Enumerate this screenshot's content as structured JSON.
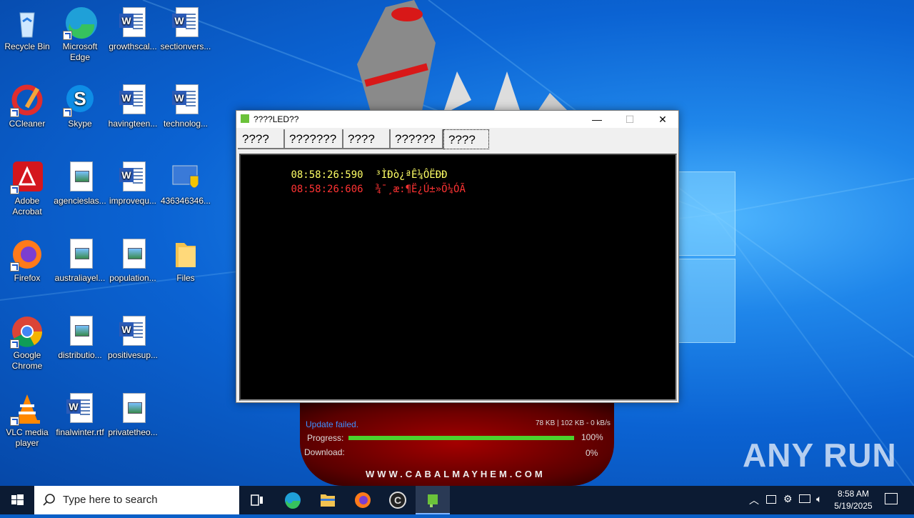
{
  "desktop": {
    "icons": [
      {
        "label": "Recycle Bin"
      },
      {
        "label": "Microsoft Edge"
      },
      {
        "label": "growthscal..."
      },
      {
        "label": "sectionvers..."
      },
      {
        "label": "CCleaner"
      },
      {
        "label": "Skype"
      },
      {
        "label": "havingteen..."
      },
      {
        "label": "technolog..."
      },
      {
        "label": "Adobe Acrobat"
      },
      {
        "label": "agencieslas..."
      },
      {
        "label": "improvequ..."
      },
      {
        "label": "436346346..."
      },
      {
        "label": "Firefox"
      },
      {
        "label": "australiayel..."
      },
      {
        "label": "population..."
      },
      {
        "label": "Files"
      },
      {
        "label": "Google Chrome"
      },
      {
        "label": "distributio..."
      },
      {
        "label": "positivesup..."
      },
      {
        "label": "VLC media player"
      },
      {
        "label": "finalwinter.rtf"
      },
      {
        "label": "privatetheo..."
      }
    ],
    "watermark": "ANY RUN"
  },
  "launcher": {
    "status": "Update failed.",
    "stats": "78 KB | 102 KB - 0 kB/s",
    "progress_label": "Progress:",
    "progress_pct": "100%",
    "progress_value": 1.0,
    "download_label": "Download:",
    "download_pct": "0%",
    "url": "WWW.CABALMAYHEM.COM"
  },
  "window": {
    "title": "????LED??",
    "minimize": "—",
    "maximize": "☐",
    "close": "✕",
    "tabs": [
      {
        "label": "????"
      },
      {
        "label": "???????"
      },
      {
        "label": "????"
      },
      {
        "label": "??????"
      },
      {
        "label": "????"
      }
    ],
    "log": [
      {
        "time": "08:58:26:590",
        "text": "³ÌÐò¿ªÊ¼ÔËÐÐ",
        "color": "#ffff66"
      },
      {
        "time": "08:58:26:606",
        "text": "¾¯¸æ:¶Ë¿Ú±»Õ¼ÓÃ",
        "color": "#ff3333"
      }
    ]
  },
  "taskbar": {
    "search_placeholder": "Type here to search",
    "time": "8:58 AM",
    "date": "5/19/2025"
  }
}
